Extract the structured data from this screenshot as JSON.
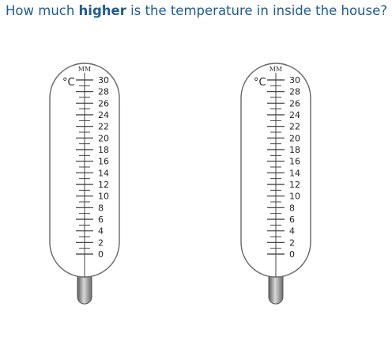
{
  "question": {
    "prefix": "How much ",
    "emphasis": "higher",
    "suffix": " is the temperature in inside the house?"
  },
  "thermometers": [
    {
      "logo": "MM",
      "unit": "°C",
      "scale_labels": [
        "30",
        "28",
        "26",
        "24",
        "22",
        "20",
        "18",
        "16",
        "14",
        "12",
        "10",
        "8",
        "6",
        "4",
        "2",
        "0"
      ]
    },
    {
      "logo": "MM",
      "unit": "°C",
      "scale_labels": [
        "30",
        "28",
        "26",
        "24",
        "22",
        "20",
        "18",
        "16",
        "14",
        "12",
        "10",
        "8",
        "6",
        "4",
        "2",
        "0"
      ]
    }
  ],
  "colors": {
    "question_text": "#1f5b8f",
    "tube_outline": "#555555",
    "bulb_dark": "#666666",
    "bulb_light": "#c8c8c8"
  }
}
